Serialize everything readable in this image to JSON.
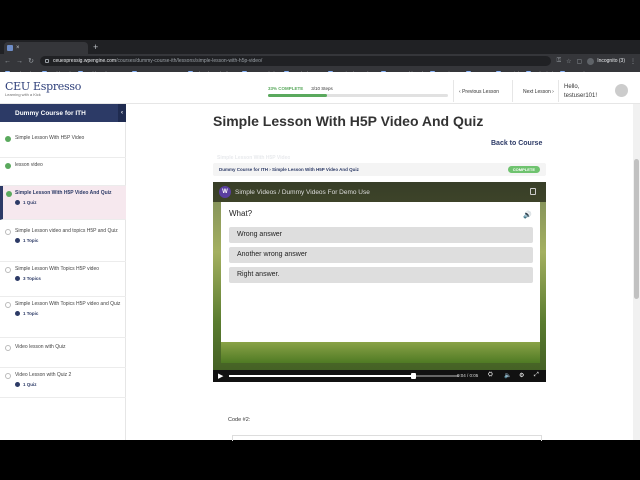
{
  "browser": {
    "tab_title": "Simple Lesson With H5P Video",
    "url_host": "ceuespressig.wpengine.com",
    "url_path": "/courses/dummy-course-ith/lessons/simple-lesson-with-h5p-video/",
    "incognito_label": "Incognito (3)",
    "bookmarks": [
      "Bookmarks",
      "Dashboard",
      "Dashboard ‹ A Wo...",
      "CEU Espresso Pag...",
      "Inbox (1,613) - jim...",
      "Font Symbols",
      "2 O'clock Scan",
      "sucuri - clear web...",
      "ASHA Dashboard",
      "1 Business",
      "2 Home",
      "3 Social",
      "4 Physical",
      "5 Mental"
    ]
  },
  "header": {
    "logo_text": "CEU Espresso",
    "logo_tagline": "Learning with a Kick",
    "progress_label": "33% COMPLETE",
    "progress_steps": "3/10 Steps",
    "progress_value": 0.33,
    "prev_lesson": "Previous Lesson",
    "next_lesson": "Next Lesson",
    "hello": "Hello,",
    "username": "testuser101!"
  },
  "sidebar": {
    "course_title": "Dummy Course for ITH",
    "items": [
      {
        "label": "Simple Lesson With H5P Video",
        "done": true
      },
      {
        "label": "lesson video",
        "done": true
      },
      {
        "label": "Simple Lesson With H5P Video And Quiz",
        "done": true,
        "active": true,
        "sub": "1 Quiz"
      },
      {
        "label": "Simple Lesson video and topics H5P and Quiz",
        "done": false,
        "sub": "1 Topic"
      },
      {
        "label": "Simple Lesson With Topics H5P video",
        "done": false,
        "sub": "3 Topics"
      },
      {
        "label": "Simple Lesson With Topics H5P video and Quiz",
        "done": false,
        "sub": "1 Topic"
      },
      {
        "label": "Video lesson with Quiz",
        "done": false
      },
      {
        "label": "Video Lesson with Quiz 2",
        "done": false,
        "sub": "1 Quiz"
      }
    ]
  },
  "main": {
    "title": "Simple Lesson With H5P Video And Quiz",
    "back_link": "Back to Course",
    "breadcrumb": "Dummy Course for ITH › Simple Lesson With H5P Video And Quiz",
    "status_badge": "COMPLETE",
    "code_label": "Code #2:"
  },
  "video": {
    "channel_letter": "W",
    "title": "Simple Videos / Dummy Videos For Demo Use",
    "question": "What?",
    "answers": [
      "Wrong answer",
      "Another wrong answer",
      "Right answer."
    ],
    "time": "0:04",
    "duration": "0:05",
    "progress_value": 0.8
  },
  "colors": {
    "brand_navy": "#2c3a66",
    "complete_green": "#5aa95d"
  },
  "icons": {
    "back": "arrow-left",
    "forward": "arrow-right",
    "reload": "reload",
    "check": "check-circle",
    "sound": "speaker",
    "play": "play",
    "fullscreen": "expand"
  }
}
